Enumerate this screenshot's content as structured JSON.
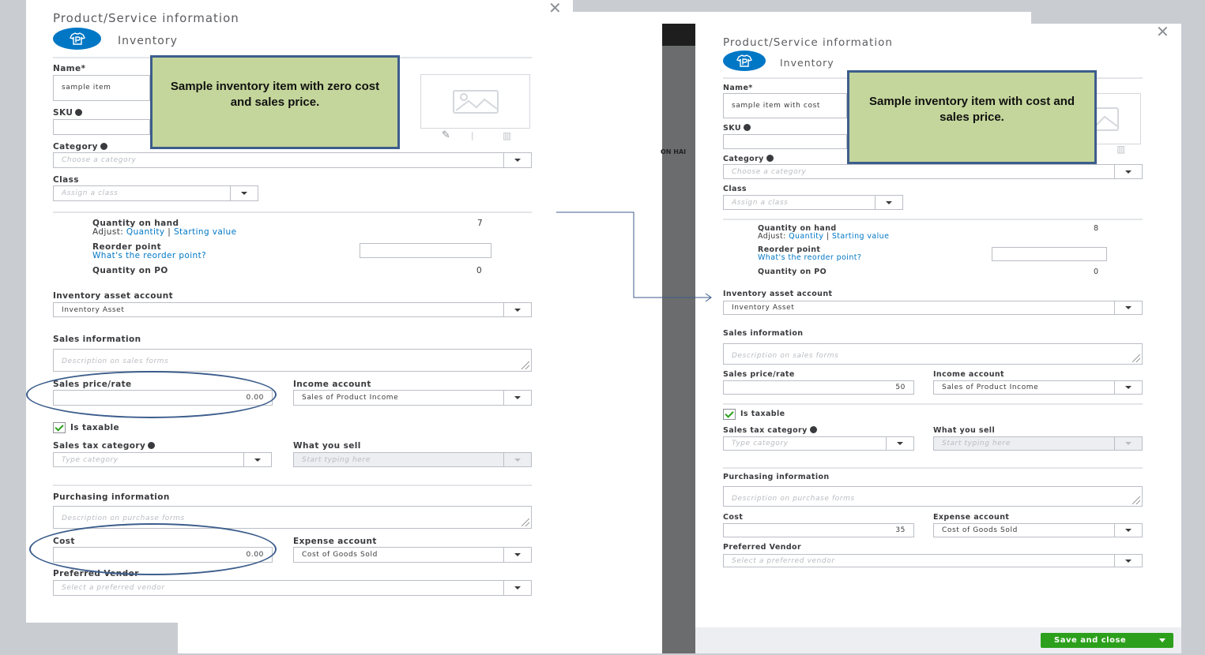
{
  "background": {
    "column_header": "ON HAI"
  },
  "colors": {
    "accent_blue": "#0077c5",
    "save_green": "#2ca01c",
    "callout_fill": "#c4d69b",
    "callout_border": "#3c5d8c"
  },
  "left": {
    "title": "Product/Service information",
    "type_label": "Inventory",
    "name_label": "Name*",
    "name_value": "sample item",
    "sku_label": "SKU",
    "category_label": "Category",
    "category_placeholder": "Choose a category",
    "class_label": "Class",
    "class_placeholder": "Assign a class",
    "qoh_label": "Quantity on hand",
    "qoh_value": "7",
    "adjust_label": "Adjust:",
    "adjust_quantity": "Quantity",
    "adjust_sep": "|",
    "adjust_starting": "Starting value",
    "reorder_label": "Reorder point",
    "reorder_link": "What's the reorder point?",
    "qpo_label": "Quantity on PO",
    "qpo_value": "0",
    "inv_asset_label": "Inventory asset account",
    "inv_asset_value": "Inventory Asset",
    "sales_info_label": "Sales information",
    "sales_desc_placeholder": "Description on sales forms",
    "sales_price_label": "Sales price/rate",
    "sales_price_value": "0.00",
    "income_label": "Income account",
    "income_value": "Sales of Product Income",
    "taxable_label": "Is taxable",
    "tax_cat_label": "Sales tax category",
    "tax_cat_placeholder": "Type category",
    "what_sell_label": "What you sell",
    "what_sell_placeholder": "Start typing here",
    "purchasing_label": "Purchasing information",
    "purchase_desc_placeholder": "Description on purchase forms",
    "cost_label": "Cost",
    "cost_value": "0.00",
    "expense_label": "Expense account",
    "expense_value": "Cost of Goods Sold",
    "vendor_label": "Preferred Vendor",
    "vendor_placeholder": "Select a preferred vendor",
    "callout": "Sample inventory item with zero cost and sales price."
  },
  "right": {
    "title": "Product/Service information",
    "type_label": "Inventory",
    "name_label": "Name*",
    "name_value": "sample item with cost",
    "sku_label": "SKU",
    "category_label": "Category",
    "category_placeholder": "Choose a category",
    "class_label": "Class",
    "class_placeholder": "Assign a class",
    "qoh_label": "Quantity on hand",
    "qoh_value": "8",
    "adjust_label": "Adjust:",
    "adjust_quantity": "Quantity",
    "adjust_sep": "|",
    "adjust_starting": "Starting value",
    "reorder_label": "Reorder point",
    "reorder_link": "What's the reorder point?",
    "qpo_label": "Quantity on PO",
    "qpo_value": "0",
    "inv_asset_label": "Inventory asset account",
    "inv_asset_value": "Inventory Asset",
    "sales_info_label": "Sales information",
    "sales_desc_placeholder": "Description on sales forms",
    "sales_price_label": "Sales price/rate",
    "sales_price_value": "50",
    "income_label": "Income account",
    "income_value": "Sales of Product Income",
    "taxable_label": "Is taxable",
    "tax_cat_label": "Sales tax category",
    "tax_cat_placeholder": "Type category",
    "what_sell_label": "What you sell",
    "what_sell_placeholder": "Start typing here",
    "purchasing_label": "Purchasing information",
    "purchase_desc_placeholder": "Description on purchase forms",
    "cost_label": "Cost",
    "cost_value": "35",
    "expense_label": "Expense account",
    "expense_value": "Cost of Goods Sold",
    "vendor_label": "Preferred Vendor",
    "vendor_placeholder": "Select a preferred vendor",
    "callout": "Sample inventory item with cost and sales price.",
    "save_label": "Save and close"
  }
}
